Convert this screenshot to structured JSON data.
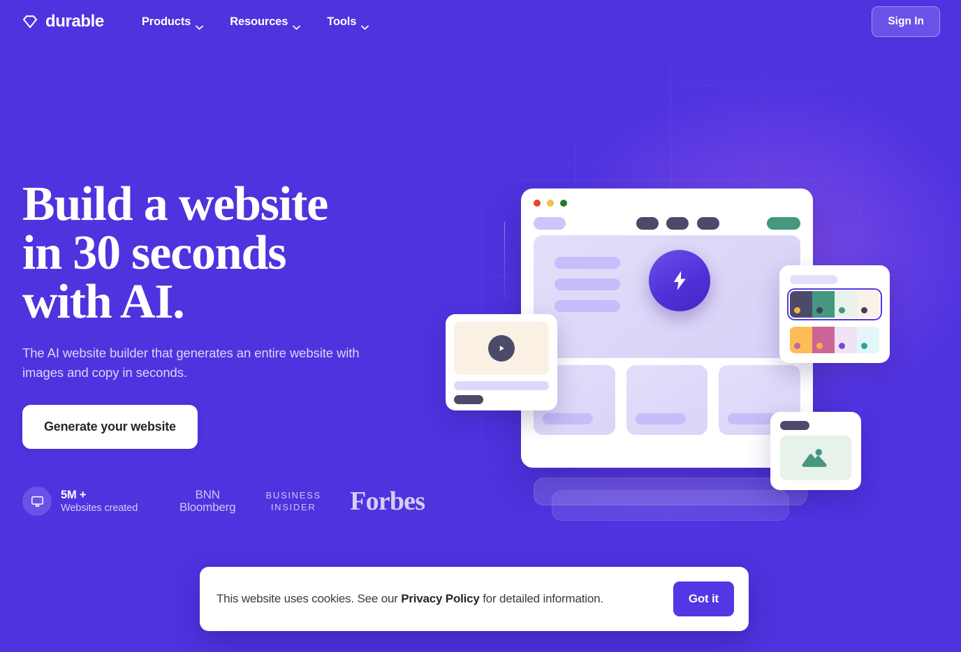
{
  "brand": {
    "name": "durable",
    "logo_icon": "diamond-gem-icon"
  },
  "nav": {
    "items": [
      {
        "label": "Products",
        "icon": "chevron-down-icon"
      },
      {
        "label": "Resources",
        "icon": "chevron-down-icon"
      },
      {
        "label": "Tools",
        "icon": "chevron-down-icon"
      }
    ],
    "signin_label": "Sign In"
  },
  "hero": {
    "headline_line1": "Build a website",
    "headline_line2": "in 30 seconds",
    "headline_line3": "with AI.",
    "subheadline": "The AI website builder that generates an entire website with images and copy in seconds.",
    "cta_label": "Generate your website"
  },
  "social_proof": {
    "stat_icon": "monitor-icon",
    "stat_value": "5M +",
    "stat_label": "Websites created",
    "logos": [
      {
        "name": "bnn-bloomberg-logo",
        "line1": "BNN",
        "line2": "Bloomberg"
      },
      {
        "name": "business-insider-logo",
        "line1": "BUSINESS",
        "line2": "INSIDER"
      },
      {
        "name": "forbes-logo",
        "text": "Forbes"
      }
    ]
  },
  "illustration": {
    "browser_dots": [
      "#e8422a",
      "#f5c141",
      "#237a2c"
    ],
    "browser_cta_color": "#45977f",
    "bolt_icon": "lightning-bolt-icon",
    "video_card": {
      "play_icon": "play-icon"
    },
    "image_card": {
      "picture_icon": "picture-icon"
    },
    "palette_card": {
      "selected_row_border": "#5436e4",
      "rows": [
        {
          "selected": true,
          "swatches": [
            {
              "fill": "#4c4a69",
              "dot": "#f5b04a"
            },
            {
              "fill": "#45977f",
              "dot": "#3c4059"
            },
            {
              "fill": "#e6f2ea",
              "dot": "#3c9a7f"
            },
            {
              "fill": "#faf2e6",
              "dot": "#3c4059"
            }
          ]
        },
        {
          "selected": false,
          "swatches": [
            {
              "fill": "#fcbd56",
              "dot": "#c2659b"
            },
            {
              "fill": "#cd6594",
              "dot": "#f5b04a"
            },
            {
              "fill": "#efe4f6",
              "dot": "#7d45d6"
            },
            {
              "fill": "#e4f6f7",
              "dot": "#23a7ae"
            }
          ]
        }
      ]
    }
  },
  "cookie_banner": {
    "text_before": "This website uses cookies. See our ",
    "link_label": "Privacy Policy",
    "text_after": " for detailed information.",
    "button_label": "Got it"
  },
  "colors": {
    "background": "#4e33df",
    "accent": "#5436e4",
    "signin_fill": "#6a52e8"
  }
}
